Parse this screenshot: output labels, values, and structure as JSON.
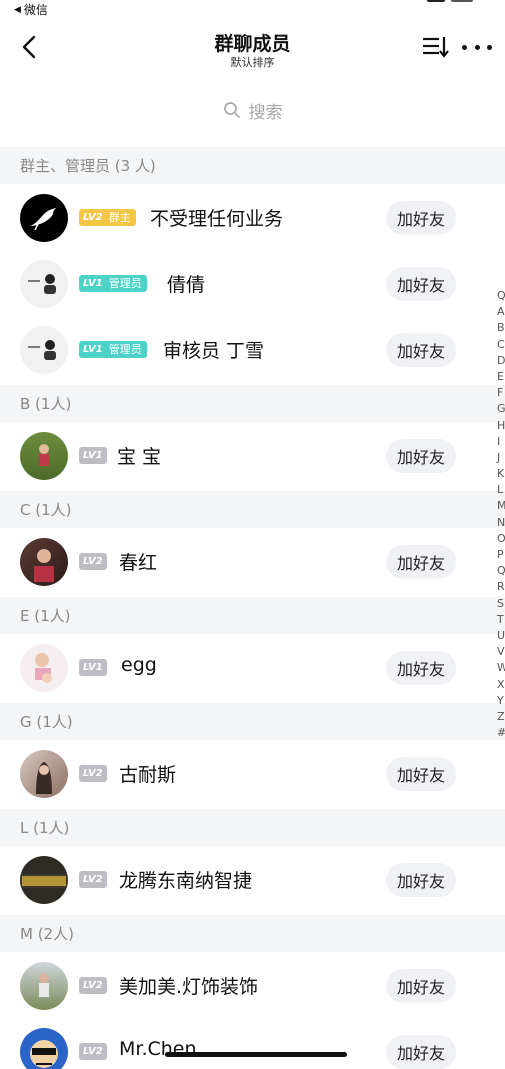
{
  "status_bar": {
    "back_label": "微信"
  },
  "nav": {
    "title": "群聊成员",
    "subtitle": "默认排序"
  },
  "search": {
    "placeholder": "搜索"
  },
  "add_friend_label": "加好友",
  "colors": {
    "owner_badge": "#f3c646",
    "admin_badge": "#4cd2c7",
    "member_badge": "#bdbdc4",
    "section_bg": "#f4f5f7"
  },
  "sections": [
    {
      "header": "群主、管理员 (3 人)",
      "members": [
        {
          "level": "LV2",
          "role": "群主",
          "name": "不受理任何业务"
        },
        {
          "level": "LV1",
          "role": "管理员",
          "name": "倩倩"
        },
        {
          "level": "LV1",
          "role": "管理员",
          "name": "审核员 丁雪"
        }
      ]
    },
    {
      "header": "B (1人)",
      "members": [
        {
          "level": "LV1",
          "name": "宝 宝"
        }
      ]
    },
    {
      "header": "C (1人)",
      "members": [
        {
          "level": "LV2",
          "name": "春红"
        }
      ]
    },
    {
      "header": "E (1人)",
      "members": [
        {
          "level": "LV1",
          "name": "egg"
        }
      ]
    },
    {
      "header": "G (1人)",
      "members": [
        {
          "level": "LV2",
          "name": "古耐斯"
        }
      ]
    },
    {
      "header": "L (1人)",
      "members": [
        {
          "level": "LV2",
          "name": "龙腾东南纳智捷"
        }
      ]
    },
    {
      "header": "M (2人)",
      "members": [
        {
          "level": "LV2",
          "name": "美加美.灯饰装饰"
        },
        {
          "level": "LV2",
          "name": "Mr.Chen"
        }
      ]
    }
  ],
  "index_letters": [
    "Q",
    "A",
    "B",
    "C",
    "D",
    "E",
    "F",
    "G",
    "H",
    "I",
    "J",
    "K",
    "L",
    "M",
    "N",
    "O",
    "P",
    "Q",
    "R",
    "S",
    "T",
    "U",
    "V",
    "W",
    "X",
    "Y",
    "Z",
    "#"
  ]
}
